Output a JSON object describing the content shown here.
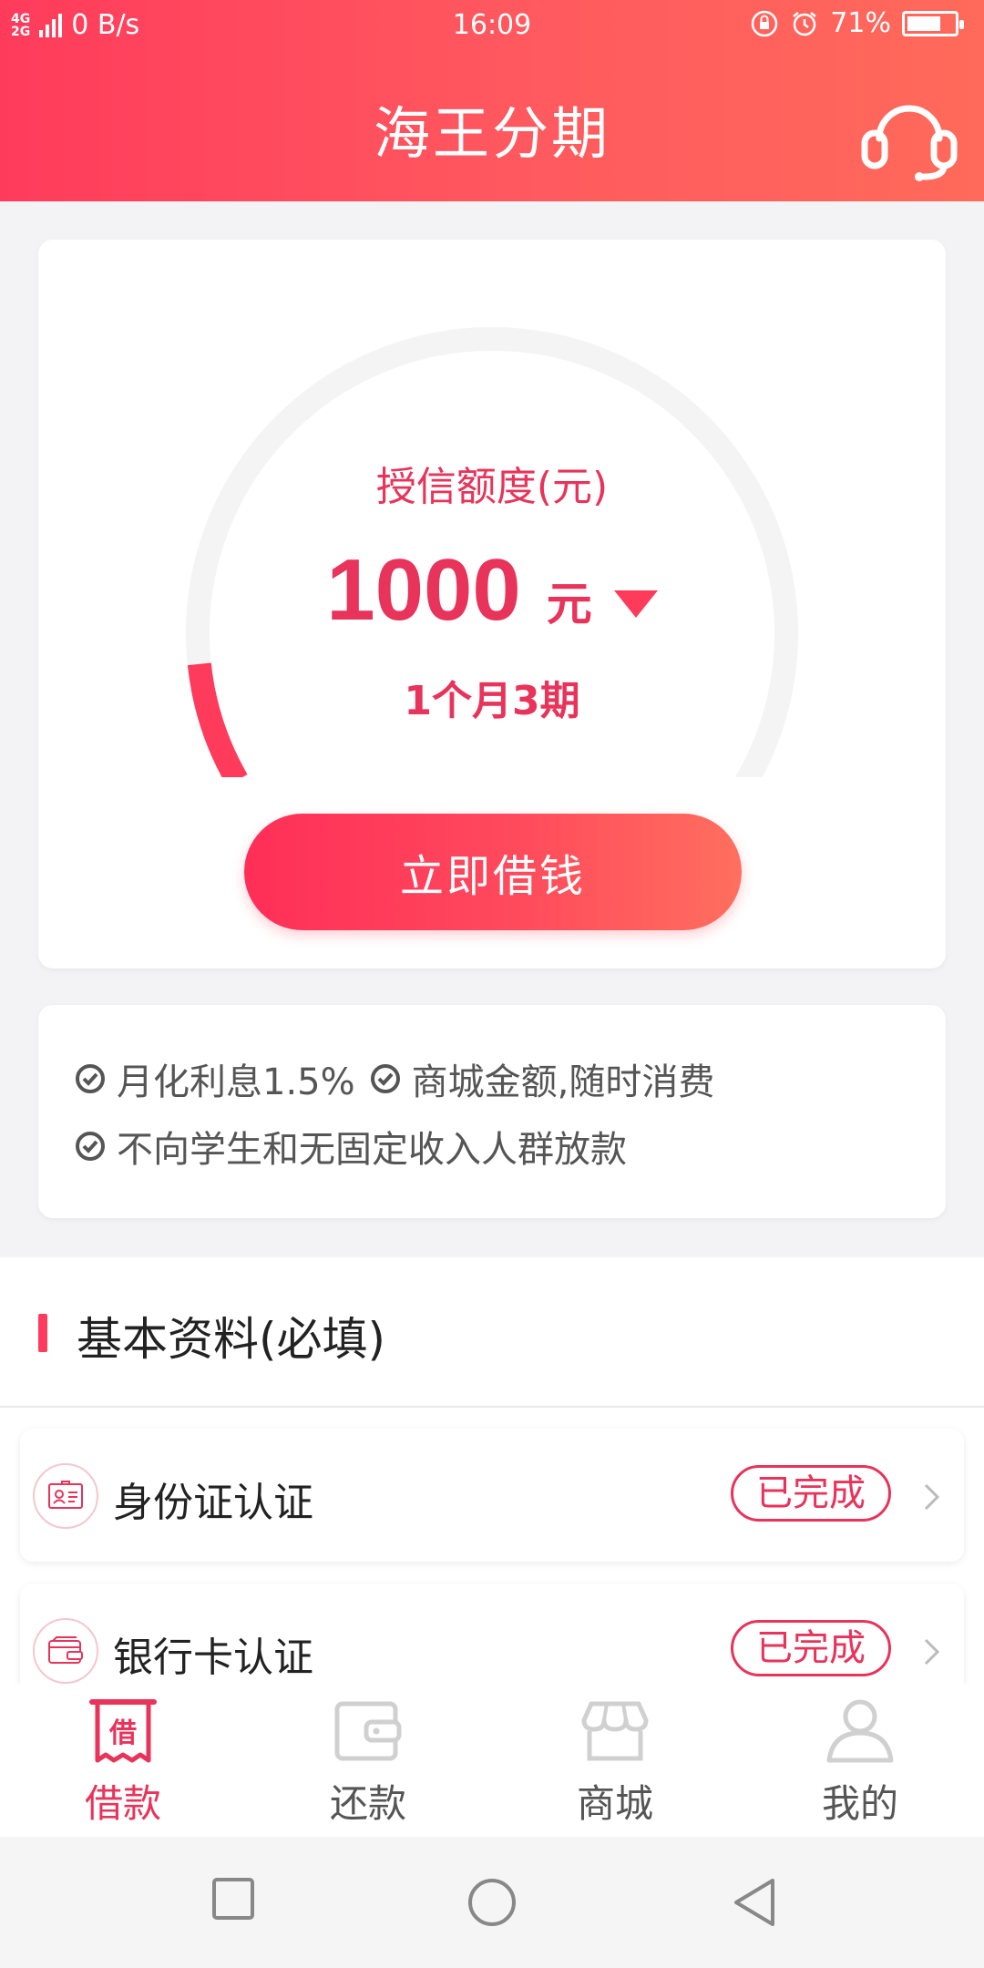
{
  "status_bar": {
    "network_top": "4G",
    "network_bottom": "2G",
    "speed": "0 B/s",
    "time": "16:09",
    "battery": "71%",
    "battery_level": 0.71
  },
  "header": {
    "title": "海王分期",
    "icons": [
      "headset-icon"
    ]
  },
  "credit": {
    "label": "授信额度(元)",
    "amount": "1000",
    "unit": "元",
    "term": "1个月3期",
    "gauge_progress": 0.08,
    "borrow_button": "立即借钱"
  },
  "features": {
    "line1_a": "月化利息1.5%",
    "line1_b": "商城金额,随时消费",
    "line2": "不向学生和无固定收入人群放款"
  },
  "basic_info": {
    "title": "基本资料(必填)",
    "items": [
      {
        "label": "身份证认证",
        "status": "已完成",
        "icon": "id-card-icon"
      },
      {
        "label": "银行卡认证",
        "status": "已完成",
        "icon": "bank-card-icon"
      }
    ]
  },
  "tabs": [
    {
      "label": "借款",
      "icon_text": "借",
      "active": true
    },
    {
      "label": "还款",
      "active": false
    },
    {
      "label": "商城",
      "active": false
    },
    {
      "label": "我的",
      "active": false
    }
  ],
  "colors": {
    "accent": "#e8335a",
    "header_start": "#ff3b5c",
    "header_end": "#ff6a5a"
  }
}
